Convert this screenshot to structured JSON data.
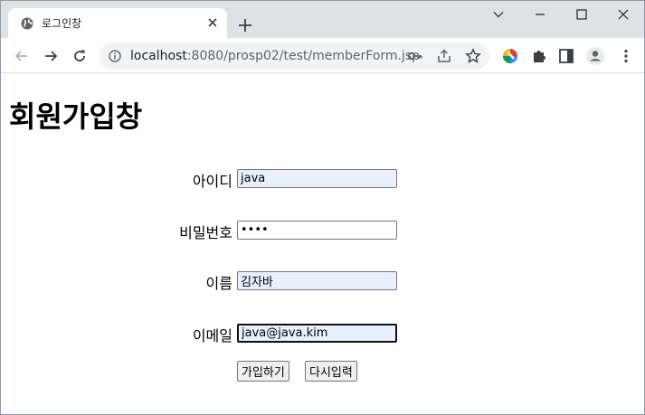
{
  "browser": {
    "tab_title": "로그인창",
    "url_host": "localhost",
    "url_path": ":8080/prosp02/test/memberForm.jsp"
  },
  "page": {
    "heading": "회원가입창",
    "fields": [
      {
        "label": "아이디",
        "value": "java"
      },
      {
        "label": "비밀번호",
        "value": "••••"
      },
      {
        "label": "이름",
        "value": "김자바"
      },
      {
        "label": "이메일",
        "value": "java@java.kim"
      }
    ],
    "buttons": {
      "submit": "가입하기",
      "reset": "다시입력"
    }
  }
}
